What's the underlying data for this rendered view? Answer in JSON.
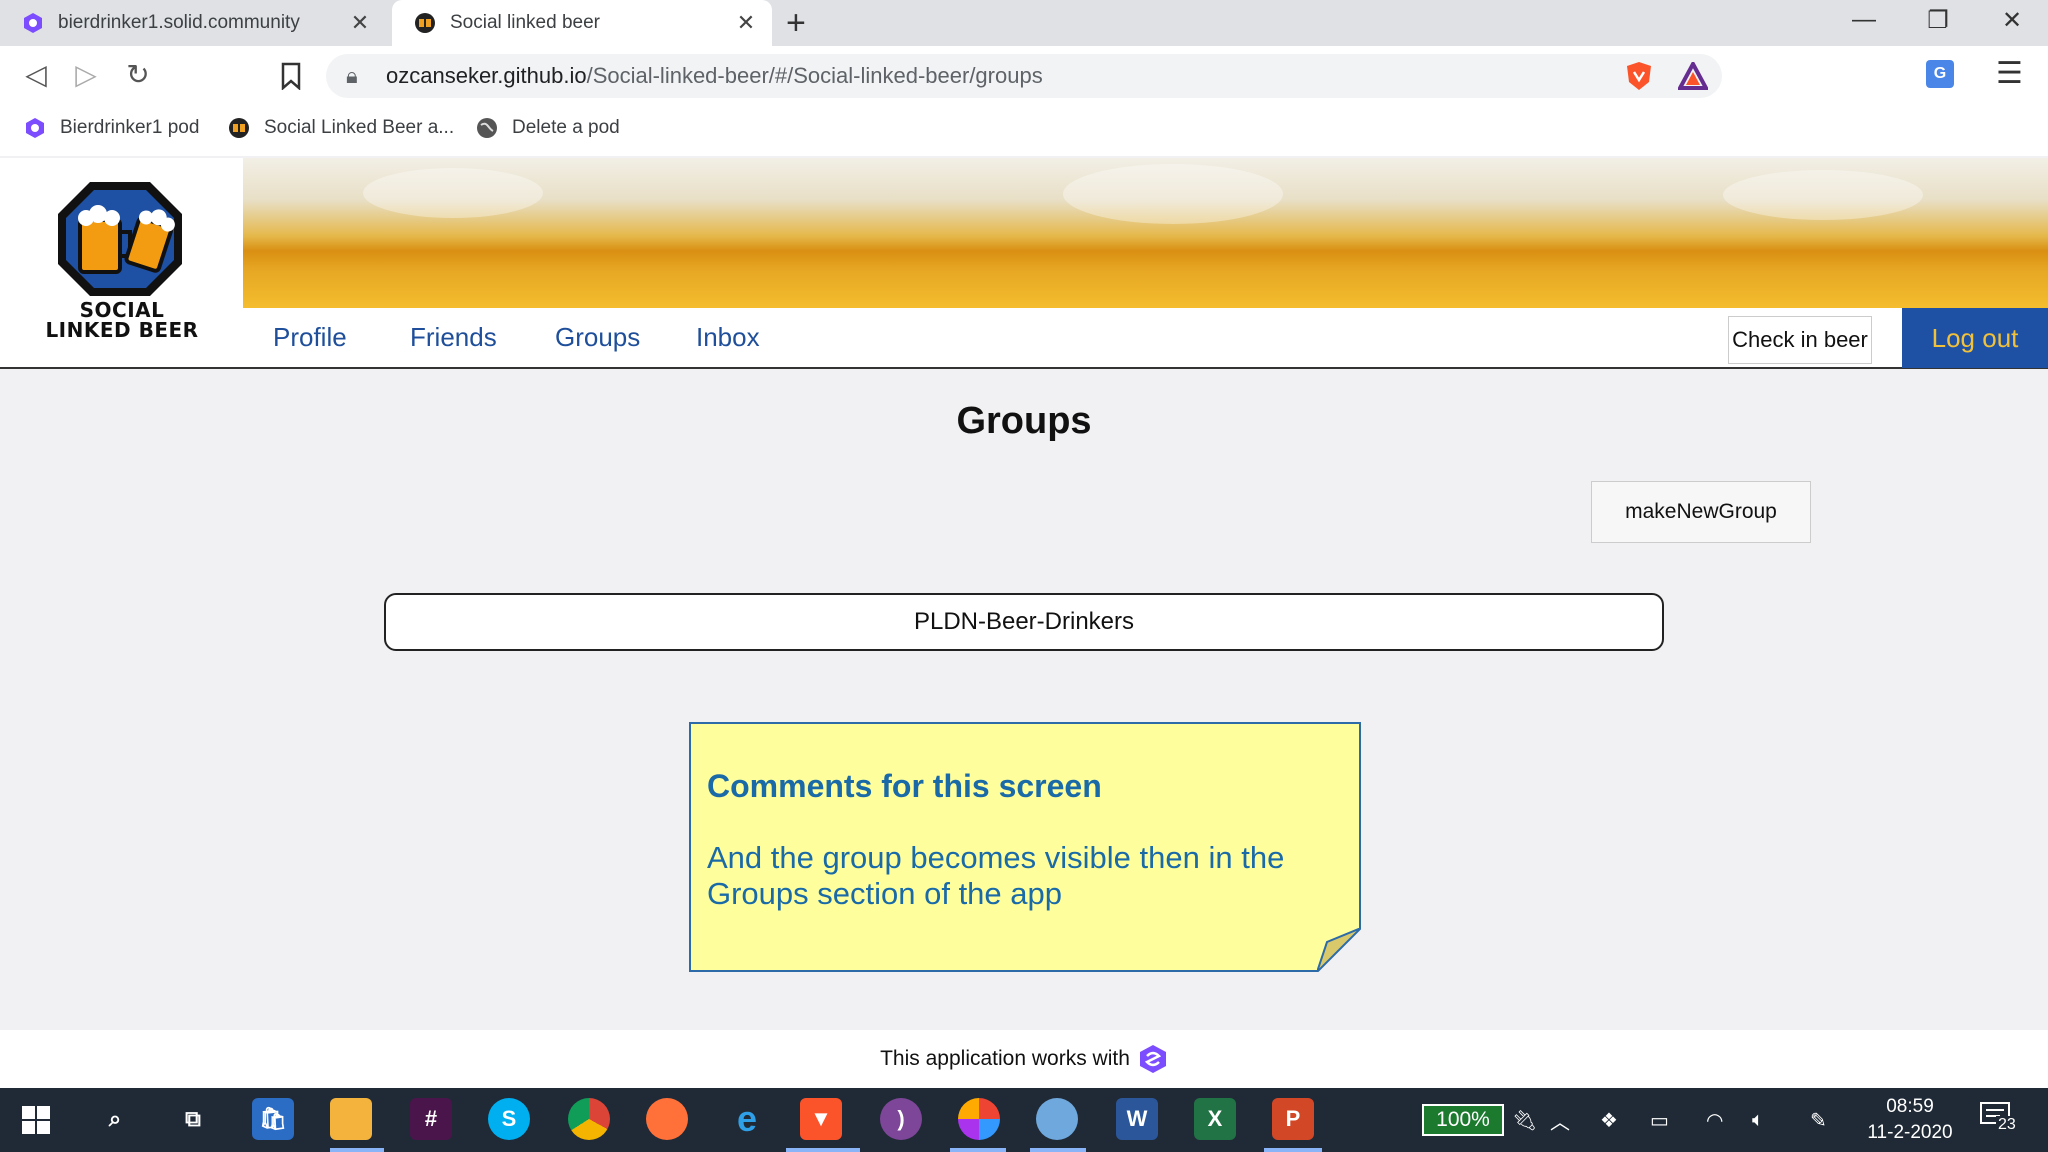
{
  "browser": {
    "tabs": [
      {
        "title": "bierdrinker1.solid.community",
        "active": false
      },
      {
        "title": "Social linked beer",
        "active": true
      }
    ],
    "new_tab": "+",
    "address_host": "ozcanseker.github.io",
    "address_path": "/Social-linked-beer/#/Social-linked-beer/groups",
    "bookmarks": [
      {
        "label": "Bierdrinker1 pod",
        "icon": "solid-icon"
      },
      {
        "label": "Social Linked Beer a...",
        "icon": "beer-logo-icon"
      },
      {
        "label": "Delete a pod",
        "icon": "globe-icon"
      }
    ]
  },
  "app": {
    "logo_line1": "SOCIAL",
    "logo_line2": "LINKED BEER",
    "nav": [
      "Profile",
      "Friends",
      "Groups",
      "Inbox"
    ],
    "checkin_label": "Check in beer",
    "logout_label": "Log out",
    "page_title": "Groups",
    "make_group_label": "makeNewGroup",
    "groups": [
      "PLDN-Beer-Drinkers"
    ],
    "note_title": "Comments for this screen",
    "note_body": "And the group becomes visible then in the Groups section of the app",
    "footer_text": "This application works with",
    "colors": {
      "nav_link": "#1f4f9a",
      "logout_bg": "#1e50a4",
      "logout_text": "#f2c13a",
      "note_bg": "#fefe9c",
      "note_text": "#1a6aa8"
    }
  },
  "taskbar": {
    "battery": "100%",
    "time": "08:59",
    "date": "11-2-2020",
    "notification_count": "23"
  }
}
